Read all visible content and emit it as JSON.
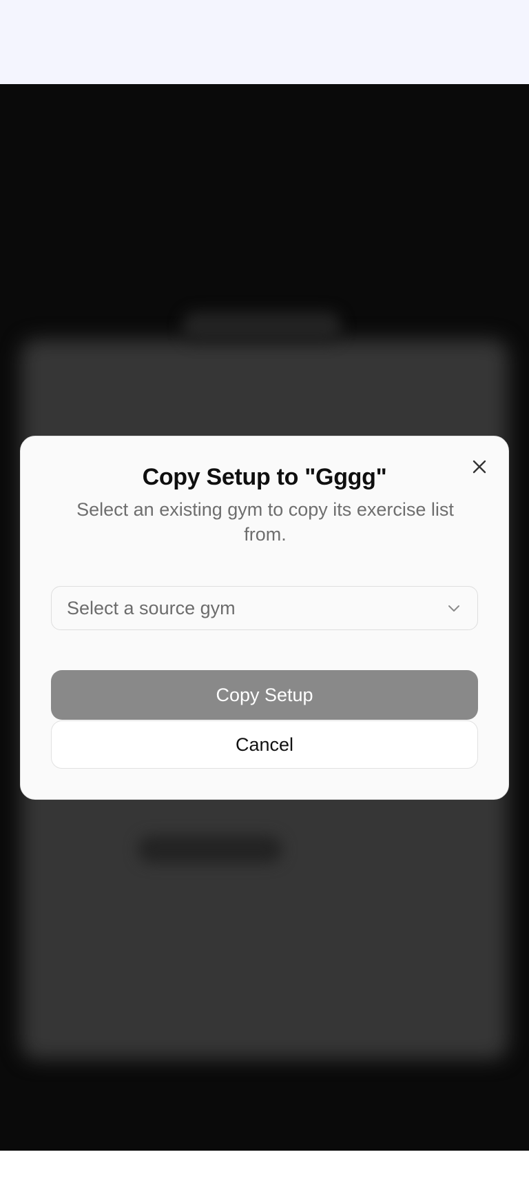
{
  "modal": {
    "title": "Copy Setup to \"Gggg\"",
    "subtitle": "Select an existing gym to copy its exercise list from.",
    "select": {
      "placeholder": "Select a source gym"
    },
    "primary_button": "Copy Setup",
    "secondary_button": "Cancel",
    "close_icon": "close-icon"
  },
  "colors": {
    "overlay": "#0a0a0a",
    "modal_bg": "#fafafa",
    "primary_disabled": "#898989",
    "top_bar": "#f4f5fe"
  }
}
